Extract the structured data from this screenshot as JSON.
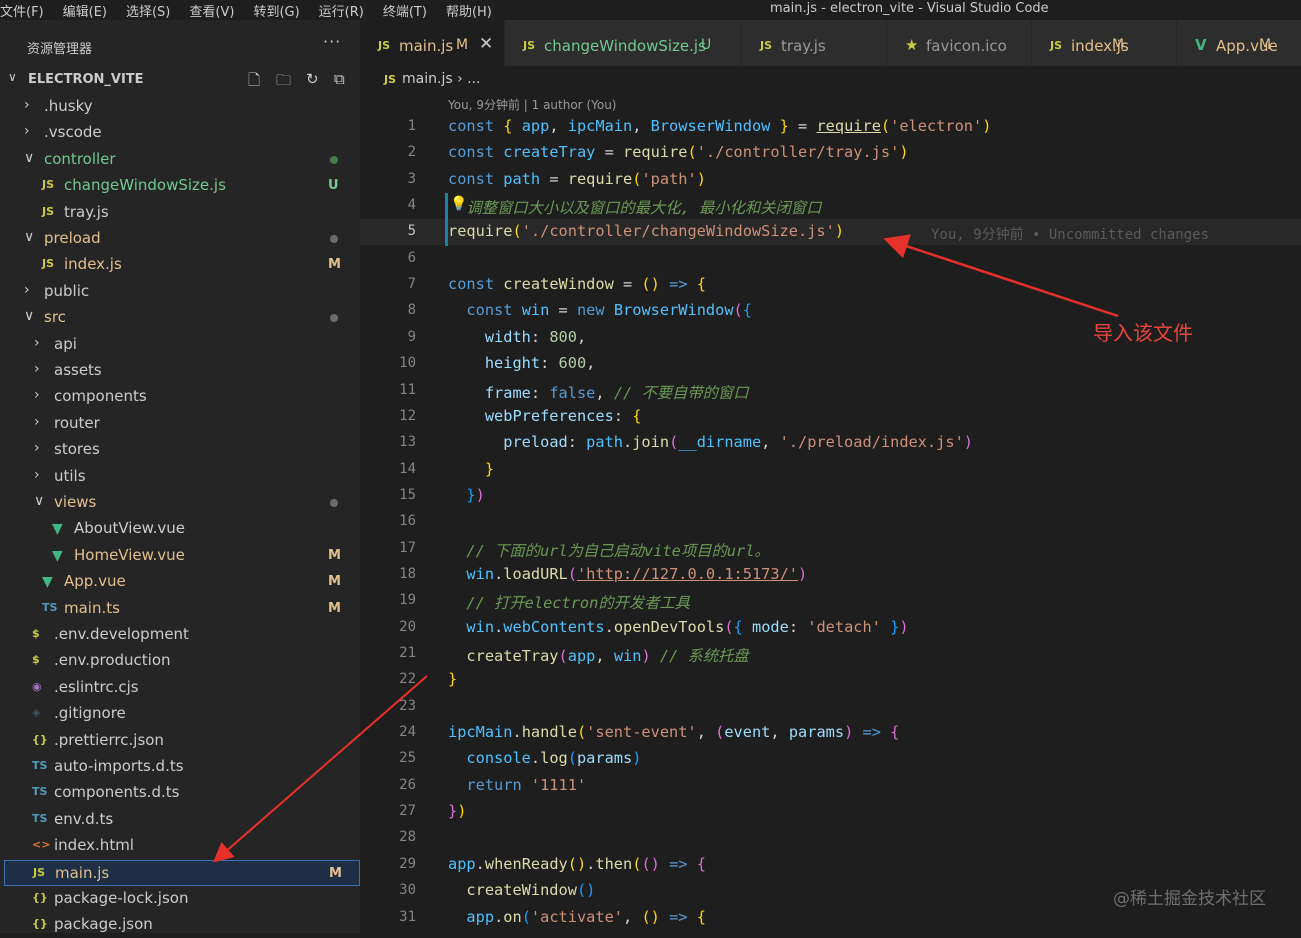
{
  "menu": [
    "文件(F)",
    "编辑(E)",
    "选择(S)",
    "查看(V)",
    "转到(G)",
    "运行(R)",
    "终端(T)",
    "帮助(H)"
  ],
  "window_title": "main.js - electron_vite - Visual Studio Code",
  "sidebar": {
    "title": "资源管理器",
    "more": "···",
    "project": "ELECTRON_VITE",
    "items": [
      {
        "label": ".husky",
        "kind": "folder-closed",
        "depth": 0,
        "color": "#cccccc",
        "badge": "",
        "dot": ""
      },
      {
        "label": ".vscode",
        "kind": "folder-closed",
        "depth": 0,
        "color": "#cccccc",
        "badge": "",
        "dot": ""
      },
      {
        "label": "controller",
        "kind": "folder-open",
        "depth": 0,
        "color": "#73c991",
        "badge": "",
        "dot": "green"
      },
      {
        "label": "changeWindowSize.js",
        "kind": "js",
        "depth": 1,
        "color": "#73c991",
        "badge": "U",
        "badgeColor": "#73c991",
        "dot": ""
      },
      {
        "label": "tray.js",
        "kind": "js",
        "depth": 1,
        "color": "#cccccc",
        "badge": "",
        "dot": ""
      },
      {
        "label": "preload",
        "kind": "folder-open",
        "depth": 0,
        "color": "#e2c08d",
        "badge": "",
        "dot": "gray"
      },
      {
        "label": "index.js",
        "kind": "js",
        "depth": 1,
        "color": "#e2c08d",
        "badge": "M",
        "badgeColor": "#e2c08d",
        "dot": ""
      },
      {
        "label": "public",
        "kind": "folder-closed",
        "depth": 0,
        "color": "#cccccc",
        "badge": "",
        "dot": ""
      },
      {
        "label": "src",
        "kind": "folder-open",
        "depth": 0,
        "color": "#e2c08d",
        "badge": "",
        "dot": "gray"
      },
      {
        "label": "api",
        "kind": "folder-closed",
        "depth": 1,
        "color": "#cccccc",
        "badge": "",
        "dot": ""
      },
      {
        "label": "assets",
        "kind": "folder-closed",
        "depth": 1,
        "color": "#cccccc",
        "badge": "",
        "dot": ""
      },
      {
        "label": "components",
        "kind": "folder-closed",
        "depth": 1,
        "color": "#cccccc",
        "badge": "",
        "dot": ""
      },
      {
        "label": "router",
        "kind": "folder-closed",
        "depth": 1,
        "color": "#cccccc",
        "badge": "",
        "dot": ""
      },
      {
        "label": "stores",
        "kind": "folder-closed",
        "depth": 1,
        "color": "#cccccc",
        "badge": "",
        "dot": ""
      },
      {
        "label": "utils",
        "kind": "folder-closed",
        "depth": 1,
        "color": "#cccccc",
        "badge": "",
        "dot": ""
      },
      {
        "label": "views",
        "kind": "folder-open",
        "depth": 1,
        "color": "#e2c08d",
        "badge": "",
        "dot": "gray"
      },
      {
        "label": "AboutView.vue",
        "kind": "vue",
        "depth": 2,
        "color": "#cccccc",
        "badge": "",
        "dot": ""
      },
      {
        "label": "HomeView.vue",
        "kind": "vue",
        "depth": 2,
        "color": "#e2c08d",
        "badge": "M",
        "badgeColor": "#e2c08d",
        "dot": ""
      },
      {
        "label": "App.vue",
        "kind": "vue",
        "depth": 1,
        "color": "#e2c08d",
        "badge": "M",
        "badgeColor": "#e2c08d",
        "dot": ""
      },
      {
        "label": "main.ts",
        "kind": "ts",
        "depth": 1,
        "color": "#e2c08d",
        "badge": "M",
        "badgeColor": "#e2c08d",
        "dot": ""
      },
      {
        "label": ".env.development",
        "kind": "env",
        "depth": 0,
        "color": "#cccccc",
        "badge": "",
        "dot": ""
      },
      {
        "label": ".env.production",
        "kind": "env",
        "depth": 0,
        "color": "#cccccc",
        "badge": "",
        "dot": ""
      },
      {
        "label": ".eslintrc.cjs",
        "kind": "eslint",
        "depth": 0,
        "color": "#cccccc",
        "badge": "",
        "dot": ""
      },
      {
        "label": ".gitignore",
        "kind": "git",
        "depth": 0,
        "color": "#cccccc",
        "badge": "",
        "dot": ""
      },
      {
        "label": ".prettierrc.json",
        "kind": "json",
        "depth": 0,
        "color": "#cccccc",
        "badge": "",
        "dot": ""
      },
      {
        "label": "auto-imports.d.ts",
        "kind": "ts",
        "depth": 0,
        "color": "#cccccc",
        "badge": "",
        "dot": ""
      },
      {
        "label": "components.d.ts",
        "kind": "ts",
        "depth": 0,
        "color": "#cccccc",
        "badge": "",
        "dot": ""
      },
      {
        "label": "env.d.ts",
        "kind": "ts",
        "depth": 0,
        "color": "#cccccc",
        "badge": "",
        "dot": ""
      },
      {
        "label": "index.html",
        "kind": "html",
        "depth": 0,
        "color": "#cccccc",
        "badge": "",
        "dot": ""
      },
      {
        "label": "main.js",
        "kind": "js",
        "depth": 0,
        "color": "#e2c08d",
        "badge": "M",
        "badgeColor": "#e2c08d",
        "dot": "",
        "selected": true
      },
      {
        "label": "package-lock.json",
        "kind": "json",
        "depth": 0,
        "color": "#cccccc",
        "badge": "",
        "dot": ""
      },
      {
        "label": "package.json",
        "kind": "json",
        "depth": 0,
        "color": "#cccccc",
        "badge": "",
        "dot": ""
      }
    ]
  },
  "tabs": [
    {
      "label": "main.js",
      "icon": "JS",
      "mark": "M",
      "active": true,
      "color": "#e2c08d",
      "close": "✕"
    },
    {
      "label": "changeWindowSize.js",
      "icon": "JS",
      "mark": "U",
      "active": false,
      "color": "#73c991"
    },
    {
      "label": "tray.js",
      "icon": "JS",
      "mark": "",
      "active": false,
      "color": "#999999"
    },
    {
      "label": "favicon.ico",
      "icon": "★",
      "mark": "",
      "active": false,
      "color": "#999999"
    },
    {
      "label": "index.js",
      "icon": "JS",
      "mark": "M",
      "active": false,
      "color": "#e2c08d"
    },
    {
      "label": "App.vue",
      "icon": "V",
      "mark": "M",
      "active": false,
      "color": "#e2c08d"
    }
  ],
  "breadcrumb": {
    "icon": "JS",
    "file": "main.js",
    "sep": "›",
    "rest": "..."
  },
  "blame_header": "You, 9分钟前 | 1 author (You)",
  "inline_blame": "You, 9分钟前 • Uncommitted changes",
  "annotation": "导入该文件",
  "watermark": "@稀土掘金技术社区",
  "code_lines": [
    [
      [
        "k",
        "const "
      ],
      [
        "b1",
        "{ "
      ],
      [
        "v",
        "app"
      ],
      [
        "o",
        ", "
      ],
      [
        "v",
        "ipcMain"
      ],
      [
        "o",
        ", "
      ],
      [
        "v",
        "BrowserWindow"
      ],
      [
        "b1",
        " }"
      ],
      [
        "o",
        " = "
      ],
      [
        "f u",
        "require"
      ],
      [
        "b1",
        "("
      ],
      [
        "s",
        "'electron'"
      ],
      [
        "b1",
        ")"
      ]
    ],
    [
      [
        "k",
        "const "
      ],
      [
        "v",
        "createTray"
      ],
      [
        "o",
        " = "
      ],
      [
        "f",
        "require"
      ],
      [
        "b1",
        "("
      ],
      [
        "s",
        "'./controller/tray.js'"
      ],
      [
        "b1",
        ")"
      ]
    ],
    [
      [
        "k",
        "const "
      ],
      [
        "v",
        "path"
      ],
      [
        "o",
        " = "
      ],
      [
        "f",
        "require"
      ],
      [
        "b1",
        "("
      ],
      [
        "s",
        "'path'"
      ],
      [
        "b1",
        ")"
      ]
    ],
    [
      [
        "c",
        "  调整窗口大小以及窗口的最大化, 最小化和关闭窗口"
      ]
    ],
    [
      [
        "f",
        "require"
      ],
      [
        "b1",
        "("
      ],
      [
        "s",
        "'./controller/changeWindowSize.js'"
      ],
      [
        "b1",
        ")"
      ]
    ],
    [],
    [
      [
        "k",
        "const "
      ],
      [
        "f",
        "createWindow"
      ],
      [
        "o",
        " = "
      ],
      [
        "b1",
        "()"
      ],
      [
        "o",
        " "
      ],
      [
        "k",
        "=>"
      ],
      [
        "o",
        " "
      ],
      [
        "b1",
        "{"
      ]
    ],
    [
      [
        "o",
        "  "
      ],
      [
        "k",
        "const "
      ],
      [
        "v",
        "win"
      ],
      [
        "o",
        " = "
      ],
      [
        "k",
        "new "
      ],
      [
        "v",
        "BrowserWindow"
      ],
      [
        "b2",
        "("
      ],
      [
        "b3",
        "{"
      ]
    ],
    [
      [
        "o",
        "    "
      ],
      [
        "p",
        "width"
      ],
      [
        "o",
        ": "
      ],
      [
        "n",
        "800"
      ],
      [
        "o",
        ","
      ]
    ],
    [
      [
        "o",
        "    "
      ],
      [
        "p",
        "height"
      ],
      [
        "o",
        ": "
      ],
      [
        "n",
        "600"
      ],
      [
        "o",
        ","
      ]
    ],
    [
      [
        "o",
        "    "
      ],
      [
        "p",
        "frame"
      ],
      [
        "o",
        ": "
      ],
      [
        "k",
        "false"
      ],
      [
        "o",
        ", "
      ],
      [
        "c",
        "// 不要自带的窗口"
      ]
    ],
    [
      [
        "o",
        "    "
      ],
      [
        "p",
        "webPreferences"
      ],
      [
        "o",
        ": "
      ],
      [
        "b1",
        "{"
      ]
    ],
    [
      [
        "o",
        "      "
      ],
      [
        "p",
        "preload"
      ],
      [
        "o",
        ": "
      ],
      [
        "v",
        "path"
      ],
      [
        "o",
        "."
      ],
      [
        "f",
        "join"
      ],
      [
        "b2",
        "("
      ],
      [
        "v",
        "__dirname"
      ],
      [
        "o",
        ", "
      ],
      [
        "s",
        "'./preload/index.js'"
      ],
      [
        "b2",
        ")"
      ]
    ],
    [
      [
        "o",
        "    "
      ],
      [
        "b1",
        "}"
      ]
    ],
    [
      [
        "o",
        "  "
      ],
      [
        "b3",
        "}"
      ],
      [
        "b2",
        ")"
      ]
    ],
    [],
    [
      [
        "o",
        "  "
      ],
      [
        "c",
        "// 下面的url为自己启动vite项目的url。"
      ]
    ],
    [
      [
        "o",
        "  "
      ],
      [
        "v",
        "win"
      ],
      [
        "o",
        "."
      ],
      [
        "f",
        "loadURL"
      ],
      [
        "b2",
        "("
      ],
      [
        "s u",
        "'http://127.0.0.1:5173/'"
      ],
      [
        "b2",
        ")"
      ]
    ],
    [
      [
        "o",
        "  "
      ],
      [
        "c",
        "// 打开electron的开发者工具"
      ]
    ],
    [
      [
        "o",
        "  "
      ],
      [
        "v",
        "win"
      ],
      [
        "o",
        "."
      ],
      [
        "v",
        "webContents"
      ],
      [
        "o",
        "."
      ],
      [
        "f",
        "openDevTools"
      ],
      [
        "b2",
        "("
      ],
      [
        "b3",
        "{"
      ],
      [
        "o",
        " "
      ],
      [
        "p",
        "mode"
      ],
      [
        "o",
        ": "
      ],
      [
        "s",
        "'detach'"
      ],
      [
        "o",
        " "
      ],
      [
        "b3",
        "}"
      ],
      [
        "b2",
        ")"
      ]
    ],
    [
      [
        "o",
        "  "
      ],
      [
        "f",
        "createTray"
      ],
      [
        "b2",
        "("
      ],
      [
        "v",
        "app"
      ],
      [
        "o",
        ", "
      ],
      [
        "v",
        "win"
      ],
      [
        "b2",
        ")"
      ],
      [
        "o",
        " "
      ],
      [
        "c",
        "// 系统托盘"
      ]
    ],
    [
      [
        "b1",
        "}"
      ]
    ],
    [],
    [
      [
        "v",
        "ipcMain"
      ],
      [
        "o",
        "."
      ],
      [
        "f",
        "handle"
      ],
      [
        "b1",
        "("
      ],
      [
        "s",
        "'sent-event'"
      ],
      [
        "o",
        ", "
      ],
      [
        "b2",
        "("
      ],
      [
        "p",
        "event"
      ],
      [
        "o",
        ", "
      ],
      [
        "p",
        "params"
      ],
      [
        "b2",
        ")"
      ],
      [
        "o",
        " "
      ],
      [
        "k",
        "=>"
      ],
      [
        "o",
        " "
      ],
      [
        "b2",
        "{"
      ]
    ],
    [
      [
        "o",
        "  "
      ],
      [
        "v",
        "console"
      ],
      [
        "o",
        "."
      ],
      [
        "f",
        "log"
      ],
      [
        "b3",
        "("
      ],
      [
        "p",
        "params"
      ],
      [
        "b3",
        ")"
      ]
    ],
    [
      [
        "o",
        "  "
      ],
      [
        "k",
        "return "
      ],
      [
        "s",
        "'1111'"
      ]
    ],
    [
      [
        "b2",
        "}"
      ],
      [
        "b1",
        ")"
      ]
    ],
    [],
    [
      [
        "v",
        "app"
      ],
      [
        "o",
        "."
      ],
      [
        "f",
        "whenReady"
      ],
      [
        "b1",
        "()"
      ],
      [
        "o",
        "."
      ],
      [
        "f",
        "then"
      ],
      [
        "b1",
        "("
      ],
      [
        "b2",
        "()"
      ],
      [
        "o",
        " "
      ],
      [
        "k",
        "=>"
      ],
      [
        "o",
        " "
      ],
      [
        "b2",
        "{"
      ]
    ],
    [
      [
        "o",
        "  "
      ],
      [
        "f",
        "createWindow"
      ],
      [
        "b3",
        "()"
      ]
    ],
    [
      [
        "o",
        "  "
      ],
      [
        "v",
        "app"
      ],
      [
        "o",
        "."
      ],
      [
        "f",
        "on"
      ],
      [
        "b3",
        "("
      ],
      [
        "s",
        "'activate'"
      ],
      [
        "o",
        ", "
      ],
      [
        "b1",
        "()"
      ],
      [
        "o",
        " "
      ],
      [
        "k",
        "=>"
      ],
      [
        "o",
        " "
      ],
      [
        "b1",
        "{"
      ]
    ]
  ],
  "line_numbers": [
    "1",
    "2",
    "3",
    "4",
    "5",
    "6",
    "7",
    "8",
    "9",
    "10",
    "11",
    "12",
    "13",
    "14",
    "15",
    "16",
    "17",
    "18",
    "19",
    "20",
    "21",
    "22",
    "23",
    "24",
    "25",
    "26",
    "27",
    "28",
    "29",
    "30",
    "31"
  ],
  "current_line": 5,
  "colors": {
    "accent": "#007acc",
    "arrow": "#e8302a",
    "modified": "#e2c08d",
    "untracked": "#73c991"
  }
}
